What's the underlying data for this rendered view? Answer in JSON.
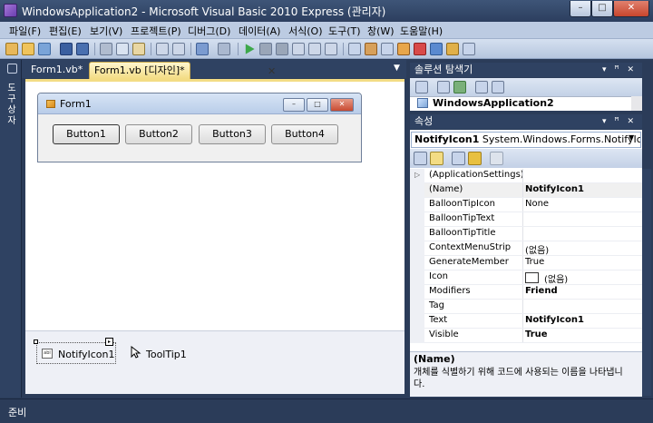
{
  "window": {
    "title": "WindowsApplication2 - Microsoft Visual Basic 2010 Express (관리자)",
    "min_glyph": "–",
    "max_glyph": "□",
    "close_glyph": "✕"
  },
  "menu": {
    "items": [
      "파일(F)",
      "편집(E)",
      "보기(V)",
      "프로젝트(P)",
      "디버그(D)",
      "데이터(A)",
      "서식(O)",
      "도구(T)",
      "창(W)",
      "도움말(H)"
    ]
  },
  "toolbox": {
    "label": "도구 상자"
  },
  "doc_tabs": {
    "tab1": "Form1.vb*",
    "tab2": "Form1.vb [디자인]*",
    "close_glyph": "✕",
    "dropdown_glyph": "▼"
  },
  "form_preview": {
    "title": "Form1",
    "buttons": [
      "Button1",
      "Button2",
      "Button3",
      "Button4"
    ],
    "min_glyph": "–",
    "max_glyph": "□",
    "close_glyph": "✕"
  },
  "tray": {
    "notify_label": "NotifyIcon1",
    "tooltip_label": "ToolTip1",
    "smart_tag_glyph": "▸",
    "notify_icon_text": "abl"
  },
  "solution_explorer": {
    "title": "솔루션 탐색기",
    "buttons_glyph": "▾ ꟸ ✕",
    "project": "WindowsApplication2"
  },
  "properties": {
    "title": "속성",
    "buttons_glyph": "▾ ꟸ ✕",
    "object_name": "NotifyIcon1",
    "object_type": "System.Windows.Forms.NotifyIcon",
    "dropdown_glyph": "▼",
    "rows": [
      {
        "name": "(ApplicationSettings)",
        "value": "",
        "bold": false,
        "expand": "▷"
      },
      {
        "name": "(Name)",
        "value": "NotifyIcon1",
        "bold": true,
        "expand": ""
      },
      {
        "name": "BalloonTipIcon",
        "value": "None",
        "bold": false,
        "expand": ""
      },
      {
        "name": "BalloonTipText",
        "value": "",
        "bold": false,
        "expand": ""
      },
      {
        "name": "BalloonTipTitle",
        "value": "",
        "bold": false,
        "expand": ""
      },
      {
        "name": "ContextMenuStrip",
        "value": "(없음)",
        "bold": false,
        "expand": ""
      },
      {
        "name": "GenerateMember",
        "value": "True",
        "bold": false,
        "expand": ""
      },
      {
        "name": "Icon",
        "value": "(없음)",
        "bold": false,
        "expand": "",
        "swatch": true
      },
      {
        "name": "Modifiers",
        "value": "Friend",
        "bold": true,
        "expand": ""
      },
      {
        "name": "Tag",
        "value": "",
        "bold": false,
        "expand": ""
      },
      {
        "name": "Text",
        "value": "NotifyIcon1",
        "bold": true,
        "expand": ""
      },
      {
        "name": "Visible",
        "value": "True",
        "bold": true,
        "expand": ""
      }
    ],
    "description_title": "(Name)",
    "description_text": "개체를 식별하기 위해 코드에 사용되는 이름을 나타냅니다."
  },
  "status": {
    "text": "준비"
  },
  "colors": {
    "chrome": "#2f4262",
    "active_tab": "#f3dc84",
    "menu": "#bccbe2"
  }
}
